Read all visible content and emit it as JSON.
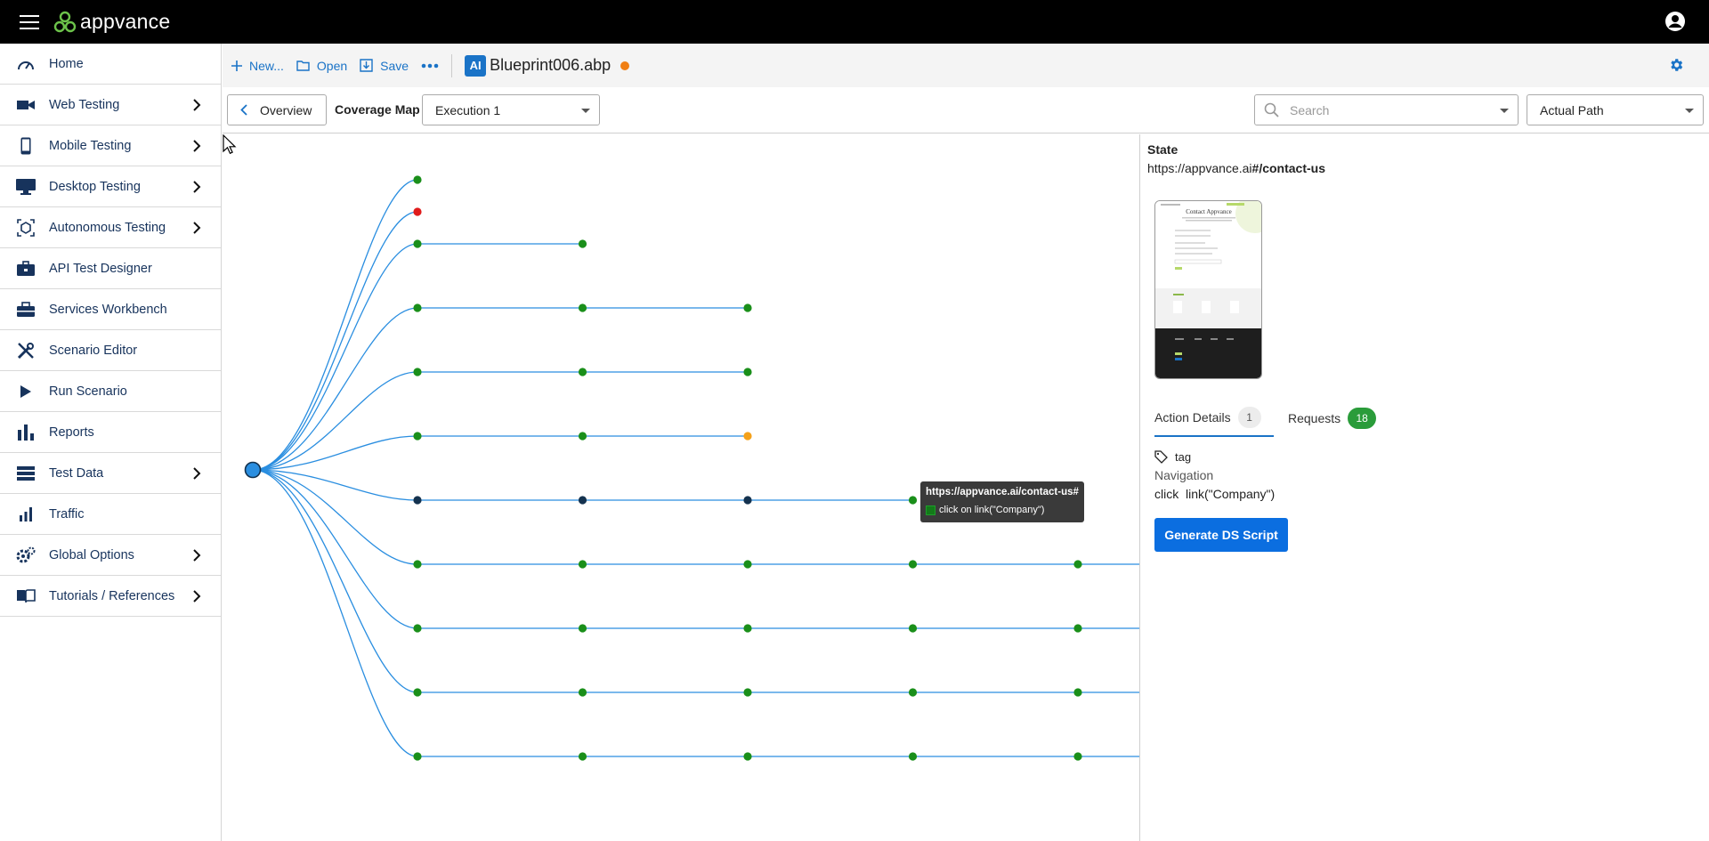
{
  "app": {
    "name": "appvance"
  },
  "sidebar": {
    "items": [
      {
        "label": "Home",
        "icon": "gauge-icon",
        "has_submenu": false
      },
      {
        "label": "Web Testing",
        "icon": "video-camera-icon",
        "has_submenu": true
      },
      {
        "label": "Mobile Testing",
        "icon": "mobile-phone-icon",
        "has_submenu": true
      },
      {
        "label": "Desktop Testing",
        "icon": "desktop-monitor-icon",
        "has_submenu": true
      },
      {
        "label": "Autonomous Testing",
        "icon": "ai-cube-icon",
        "has_submenu": true
      },
      {
        "label": "API Test Designer",
        "icon": "briefcase-icon",
        "has_submenu": false
      },
      {
        "label": "Services Workbench",
        "icon": "toolbox-icon",
        "has_submenu": false
      },
      {
        "label": "Scenario Editor",
        "icon": "tools-icon",
        "has_submenu": false
      },
      {
        "label": "Run Scenario",
        "icon": "play-icon",
        "has_submenu": false
      },
      {
        "label": "Reports",
        "icon": "bar-chart-icon",
        "has_submenu": false
      },
      {
        "label": "Test Data",
        "icon": "database-list-icon",
        "has_submenu": true
      },
      {
        "label": "Traffic",
        "icon": "traffic-chart-icon",
        "has_submenu": false
      },
      {
        "label": "Global Options",
        "icon": "gears-icon",
        "has_submenu": true
      },
      {
        "label": "Tutorials / References",
        "icon": "book-icon",
        "has_submenu": true
      }
    ]
  },
  "toolbar": {
    "new_label": "New...",
    "open_label": "Open",
    "save_label": "Save",
    "file_badge": "AI",
    "file_name": "Blueprint006.abp",
    "unsaved_color": "#f07f14"
  },
  "subheader": {
    "overview_label": "Overview",
    "coverage_map_label": "Coverage Map",
    "execution_selected": "Execution 1",
    "search_placeholder": "Search",
    "path_selected": "Actual Path"
  },
  "coverage_map": {
    "colors": {
      "edge": "#2a8ee0",
      "ok": "#1a8f1a",
      "error": "#e01b1b",
      "warning": "#f4a11a",
      "active": "#14324f",
      "root": "#2a8ee0"
    },
    "branches": [
      {
        "nodes": [
          "ok"
        ]
      },
      {
        "nodes": [
          "error"
        ]
      },
      {
        "nodes": [
          "ok",
          "ok"
        ]
      },
      {
        "nodes": [
          "ok",
          "ok",
          "ok"
        ]
      },
      {
        "nodes": [
          "ok",
          "ok",
          "ok"
        ]
      },
      {
        "nodes": [
          "ok",
          "ok",
          "warning"
        ]
      },
      {
        "nodes": [
          "active",
          "active",
          "active",
          "ok"
        ],
        "active": true
      },
      {
        "nodes": [
          "ok",
          "ok",
          "ok",
          "ok",
          "ok"
        ],
        "continues": true
      },
      {
        "nodes": [
          "ok",
          "ok",
          "ok",
          "ok",
          "ok"
        ],
        "continues": true
      },
      {
        "nodes": [
          "ok",
          "ok",
          "ok",
          "ok",
          "ok"
        ],
        "continues": true
      },
      {
        "nodes": [
          "ok",
          "ok",
          "ok",
          "ok",
          "ok"
        ],
        "continues": true
      }
    ],
    "tooltip": {
      "url": "https://appvance.ai/contact-us#",
      "action": "click on link(\"Company\")"
    }
  },
  "state_panel": {
    "title": "State",
    "url_prefix": "https://appvance.ai",
    "url_path": "#/contact-us",
    "thumbnail_heading": "Contact Appvance",
    "tabs": {
      "action_details_label": "Action Details",
      "action_details_count": "1",
      "requests_label": "Requests",
      "requests_count": "18"
    },
    "tag_label": "tag",
    "navigation_label": "Navigation",
    "action_text": "click  link(\"Company\")",
    "generate_button": "Generate DS Script"
  }
}
